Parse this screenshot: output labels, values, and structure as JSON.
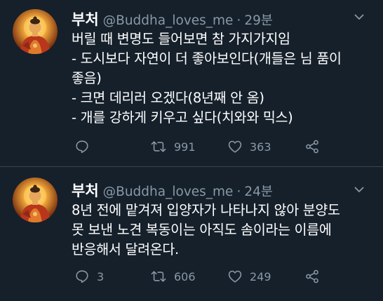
{
  "tweets": [
    {
      "display_name": "부처",
      "handle": "@Buddha_loves_me",
      "separator": "·",
      "time": "29분",
      "lines": [
        "버릴 때 변명도 들어보면 참 가지가지임",
        "- 도시보다 자연이 더 좋아보인다(개들은 님 품이",
        "좋음)",
        "- 크면 데리러 오겠다(8년째 안 옴)",
        "- 개를 강하게 키우고 싶다(치와와 믹스)"
      ],
      "replies": "",
      "retweets": "991",
      "likes": "363"
    },
    {
      "display_name": "부처",
      "handle": "@Buddha_loves_me",
      "separator": "·",
      "time": "24분",
      "lines": [
        "8년 전에 맡겨져 입양자가 나타나지 않아 분양도",
        "못 보낸 노견 복동이는 아직도 솜이라는 이름에",
        "반응해서 달려온다."
      ],
      "replies": "3",
      "retweets": "606",
      "likes": "249"
    }
  ],
  "icons": {
    "reply": "reply-icon",
    "retweet": "retweet-icon",
    "like": "heart-icon",
    "share": "share-icon",
    "caret": "chevron-down-icon"
  },
  "colors": {
    "background": "#15202b",
    "text": "#ffffff",
    "secondary": "#8899a6",
    "divider": "#38444d"
  }
}
